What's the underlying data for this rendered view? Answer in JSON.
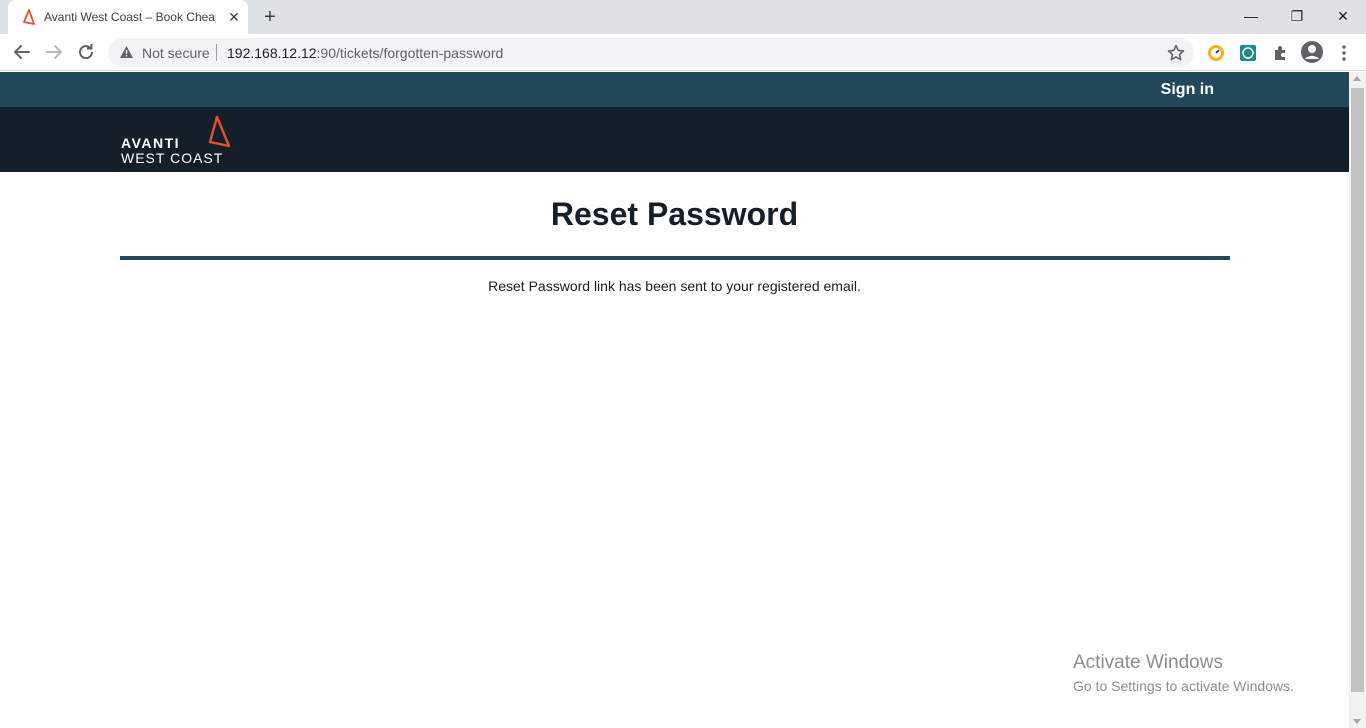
{
  "browser": {
    "tab": {
      "title": "Avanti West Coast – Book Cheap",
      "close_glyph": "✕"
    },
    "new_tab_glyph": "+",
    "window_controls": {
      "minimize": "—",
      "maximize": "❐",
      "close": "✕"
    },
    "address_bar": {
      "security_label": "Not secure",
      "url_host": "192.168.12.12",
      "url_rest": ":90/tickets/forgotten-password"
    },
    "icons": [
      "back-icon",
      "forward-icon",
      "reload-icon",
      "warning-icon",
      "star-icon",
      "speed-extension-icon",
      "green-extension-icon",
      "puzzle-extensions-icon",
      "profile-avatar-icon",
      "kebab-menu-icon"
    ]
  },
  "site": {
    "signin_label": "Sign in",
    "logo": {
      "line1": "AVANTI",
      "line2": "WEST COAST"
    },
    "colors": {
      "topbar": "#21495a",
      "brandbar": "#151f29",
      "accent": "#e8512a"
    }
  },
  "main": {
    "heading": "Reset Password",
    "message": "Reset Password link has been sent to your registered email."
  },
  "watermark": {
    "title": "Activate Windows",
    "subtitle": "Go to Settings to activate Windows."
  }
}
